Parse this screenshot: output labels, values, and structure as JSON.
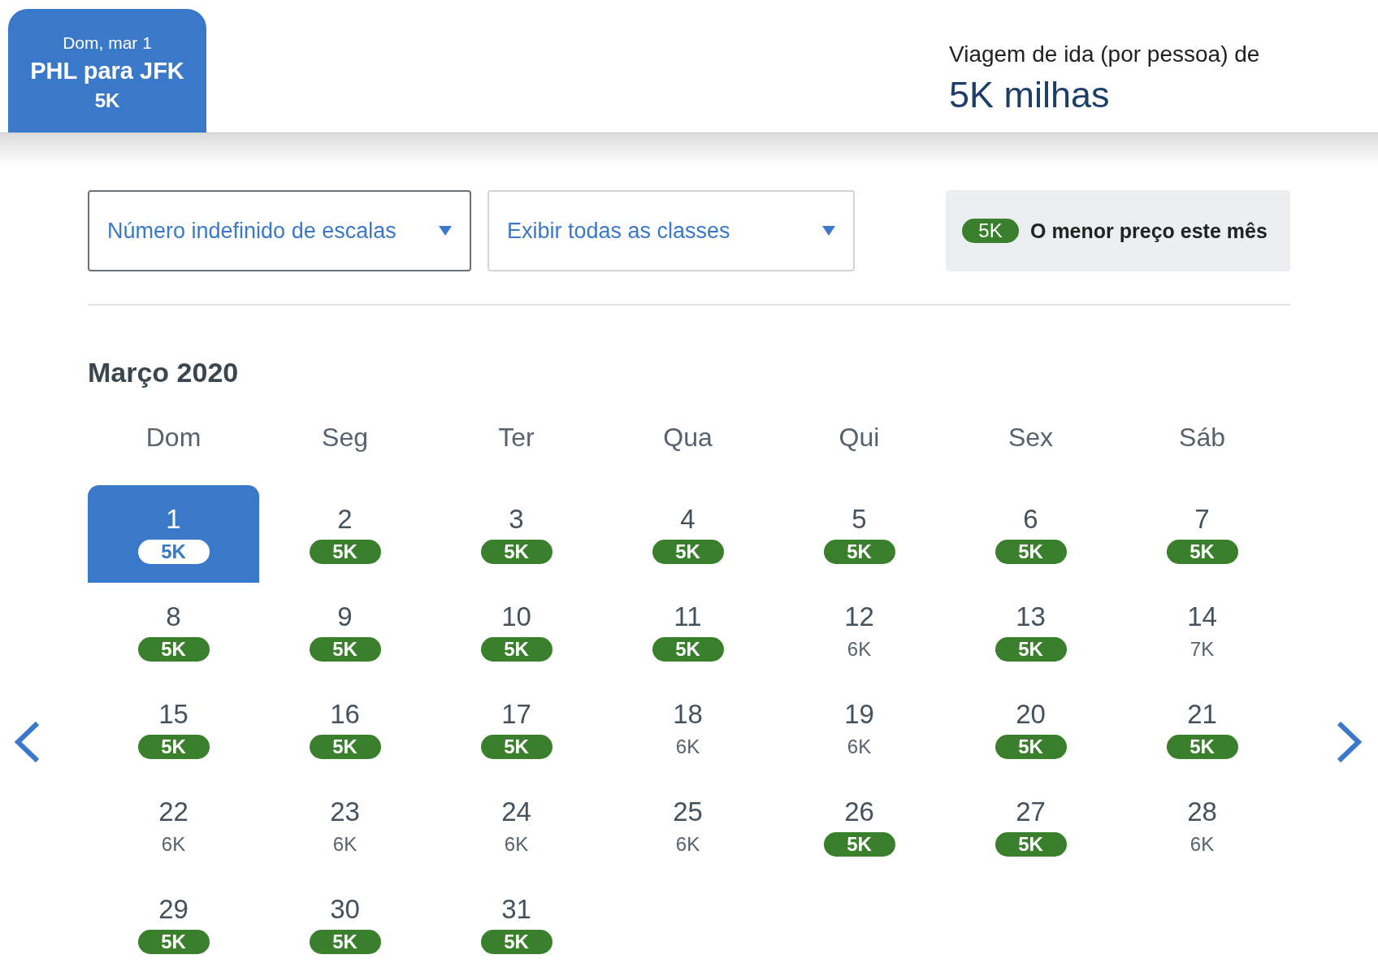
{
  "trip_tab": {
    "date": "Dom, mar 1",
    "route": "PHL para JFK",
    "price": "5K",
    "selected": true
  },
  "summary": {
    "label": "Viagem de ida (por pessoa) de",
    "price": "5K milhas"
  },
  "filters": [
    {
      "value": "Número indefinido de escalas",
      "focused": true
    },
    {
      "value": "Exibir todas as classes",
      "focused": false
    }
  ],
  "legend": {
    "badge": "5K",
    "text": "O menor preço este mês"
  },
  "calendar": {
    "title": "Março 2020",
    "weekdays": [
      "Dom",
      "Seg",
      "Ter",
      "Qua",
      "Qui",
      "Sex",
      "Sáb"
    ],
    "days": [
      {
        "day": "1",
        "price": "5K",
        "lowest": true,
        "selected": true
      },
      {
        "day": "2",
        "price": "5K",
        "lowest": true,
        "selected": false
      },
      {
        "day": "3",
        "price": "5K",
        "lowest": true,
        "selected": false
      },
      {
        "day": "4",
        "price": "5K",
        "lowest": true,
        "selected": false
      },
      {
        "day": "5",
        "price": "5K",
        "lowest": true,
        "selected": false
      },
      {
        "day": "6",
        "price": "5K",
        "lowest": true,
        "selected": false
      },
      {
        "day": "7",
        "price": "5K",
        "lowest": true,
        "selected": false
      },
      {
        "day": "8",
        "price": "5K",
        "lowest": true,
        "selected": false
      },
      {
        "day": "9",
        "price": "5K",
        "lowest": true,
        "selected": false
      },
      {
        "day": "10",
        "price": "5K",
        "lowest": true,
        "selected": false
      },
      {
        "day": "11",
        "price": "5K",
        "lowest": true,
        "selected": false
      },
      {
        "day": "12",
        "price": "6K",
        "lowest": false,
        "selected": false
      },
      {
        "day": "13",
        "price": "5K",
        "lowest": true,
        "selected": false
      },
      {
        "day": "14",
        "price": "7K",
        "lowest": false,
        "selected": false
      },
      {
        "day": "15",
        "price": "5K",
        "lowest": true,
        "selected": false
      },
      {
        "day": "16",
        "price": "5K",
        "lowest": true,
        "selected": false
      },
      {
        "day": "17",
        "price": "5K",
        "lowest": true,
        "selected": false
      },
      {
        "day": "18",
        "price": "6K",
        "lowest": false,
        "selected": false
      },
      {
        "day": "19",
        "price": "6K",
        "lowest": false,
        "selected": false
      },
      {
        "day": "20",
        "price": "5K",
        "lowest": true,
        "selected": false
      },
      {
        "day": "21",
        "price": "5K",
        "lowest": true,
        "selected": false
      },
      {
        "day": "22",
        "price": "6K",
        "lowest": false,
        "selected": false
      },
      {
        "day": "23",
        "price": "6K",
        "lowest": false,
        "selected": false
      },
      {
        "day": "24",
        "price": "6K",
        "lowest": false,
        "selected": false
      },
      {
        "day": "25",
        "price": "6K",
        "lowest": false,
        "selected": false
      },
      {
        "day": "26",
        "price": "5K",
        "lowest": true,
        "selected": false
      },
      {
        "day": "27",
        "price": "5K",
        "lowest": true,
        "selected": false
      },
      {
        "day": "28",
        "price": "6K",
        "lowest": false,
        "selected": false
      },
      {
        "day": "29",
        "price": "5K",
        "lowest": true,
        "selected": false
      },
      {
        "day": "30",
        "price": "5K",
        "lowest": true,
        "selected": false
      },
      {
        "day": "31",
        "price": "5K",
        "lowest": true,
        "selected": false
      }
    ]
  }
}
